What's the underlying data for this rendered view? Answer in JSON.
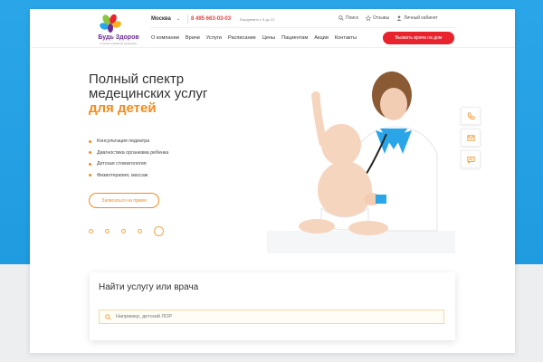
{
  "brand": {
    "name": "Будь Здоров",
    "tagline": "клиника семейной медицины"
  },
  "header": {
    "city": "Москва",
    "phone": "8 495 663-03-03",
    "hours": "Ежедневно с 9 до 21",
    "top_links": [
      {
        "label": "Поиск",
        "icon": "search-icon"
      },
      {
        "label": "Отзывы",
        "icon": "star-icon"
      },
      {
        "label": "Личный кабинет",
        "icon": "user-icon"
      }
    ],
    "nav": [
      "О компании",
      "Врачи",
      "Услуги",
      "Расписание",
      "Цены",
      "Пациентам",
      "Акции",
      "Контакты"
    ],
    "cta": "Вызвать врача на дом",
    "accent_red": "#e8232d"
  },
  "hero": {
    "title_line1": "Полный спектр",
    "title_line2": "медецинских услуг",
    "title_accent": "для детей",
    "bullets": [
      "Консультация педиатра",
      "Диагностика организма ребенка",
      "Детская стоматология",
      "Физиотерапия, массаж"
    ],
    "button": "Записаться на прием",
    "slides": 5,
    "active_slide": 5,
    "accent_orange": "#f28c1e"
  },
  "side_icons": [
    "phone-icon",
    "mail-icon",
    "chat-icon"
  ],
  "search": {
    "title": "Найти услугу или врача",
    "placeholder": "Например, детский ЛОР"
  }
}
